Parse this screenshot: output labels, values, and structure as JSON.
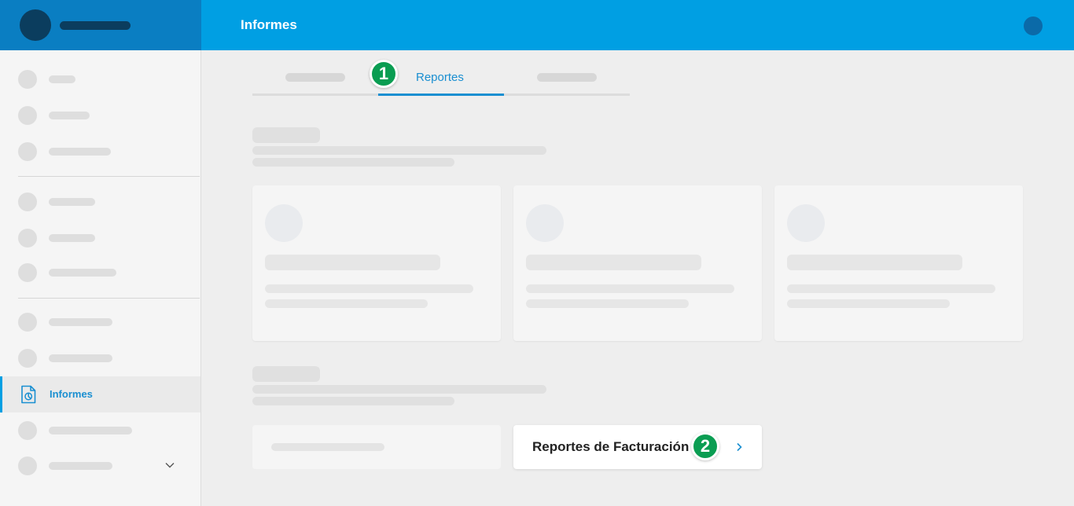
{
  "header": {
    "title": "Informes"
  },
  "sidebar": {
    "active_label": "Informes"
  },
  "tabs": {
    "active_label": "Reportes"
  },
  "badges": {
    "first": "1",
    "second": "2"
  },
  "billing_card": {
    "label": "Reportes de Facturación"
  },
  "colors": {
    "brand": "#0a7ec2",
    "topbar": "#009fe3",
    "accent": "#1a8fd1",
    "badge": "#0a9d52"
  },
  "icons": {
    "active_nav": "report-document-icon",
    "expand": "chevron-down-icon",
    "row": "chevron-right-icon"
  }
}
